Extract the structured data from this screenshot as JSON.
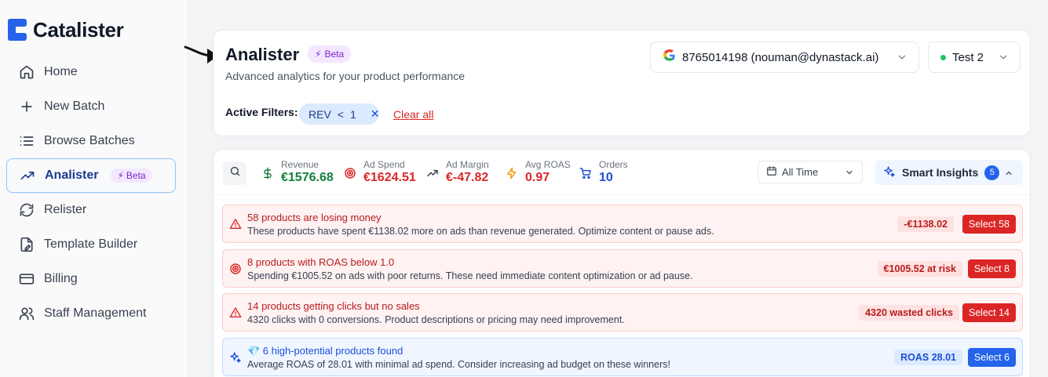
{
  "brand": {
    "name": "Catalister",
    "accent": "#2563eb"
  },
  "sidebar": {
    "items": [
      {
        "label": "Home",
        "icon": "home-icon"
      },
      {
        "label": "New Batch",
        "icon": "plus-icon"
      },
      {
        "label": "Browse Batches",
        "icon": "list-icon"
      },
      {
        "label": "Analister",
        "icon": "trending-up-icon",
        "badge": "Beta",
        "active": true
      },
      {
        "label": "Relister",
        "icon": "refresh-icon"
      },
      {
        "label": "Template Builder",
        "icon": "file-edit-icon"
      },
      {
        "label": "Billing",
        "icon": "credit-card-icon"
      },
      {
        "label": "Staff Management",
        "icon": "users-icon"
      }
    ]
  },
  "header": {
    "title": "Analister",
    "badge": "Beta",
    "subtitle": "Advanced analytics for your product performance",
    "account": "8765014198 (nouman@dynastack.ai)",
    "store": "Test 2",
    "filters_label": "Active Filters:",
    "filter_chip": {
      "field": "REV",
      "op": "<",
      "value": "1"
    },
    "clear_all": "Clear all"
  },
  "stats": [
    {
      "label": "Revenue",
      "value": "€1576.68",
      "color": "#15803d",
      "icon": "dollar-icon"
    },
    {
      "label": "Ad Spend",
      "value": "€1624.51",
      "color": "#dc2626",
      "icon": "target-icon"
    },
    {
      "label": "Ad Margin",
      "value": "€-47.82",
      "color": "#dc2626",
      "icon": "trending-up-icon"
    },
    {
      "label": "Avg ROAS",
      "value": "0.97",
      "color": "#dc2626",
      "icon": "zap-icon"
    },
    {
      "label": "Orders",
      "value": "10",
      "color": "#1d4ed8",
      "icon": "cart-icon"
    }
  ],
  "time_range": "All Time",
  "insights": {
    "label": "Smart Insights",
    "count": "5"
  },
  "alerts": [
    {
      "tone": "red",
      "icon": "warning-icon",
      "title": "58 products are losing money",
      "desc": "These products have spent €1138.02 more on ads than revenue generated. Optimize content or pause ads.",
      "pill": "-€1138.02",
      "button": "Select 58"
    },
    {
      "tone": "red",
      "icon": "target-icon",
      "title": "8 products with ROAS below 1.0",
      "desc": "Spending €1005.52 on ads with poor returns. These need immediate content optimization or ad pause.",
      "pill": "€1005.52 at risk",
      "button": "Select 8"
    },
    {
      "tone": "red",
      "icon": "warning-icon",
      "title": "14 products getting clicks but no sales",
      "desc": "4320 clicks with 0 conversions. Product descriptions or pricing may need improvement.",
      "pill": "4320 wasted clicks",
      "button": "Select 14"
    },
    {
      "tone": "blue",
      "icon": "sparkles-icon",
      "title": "💎 6 high-potential products found",
      "desc": "Average ROAS of 28.01 with minimal ad spend. Consider increasing ad budget on these winners!",
      "pill": "ROAS 28.01",
      "button": "Select 6"
    }
  ]
}
